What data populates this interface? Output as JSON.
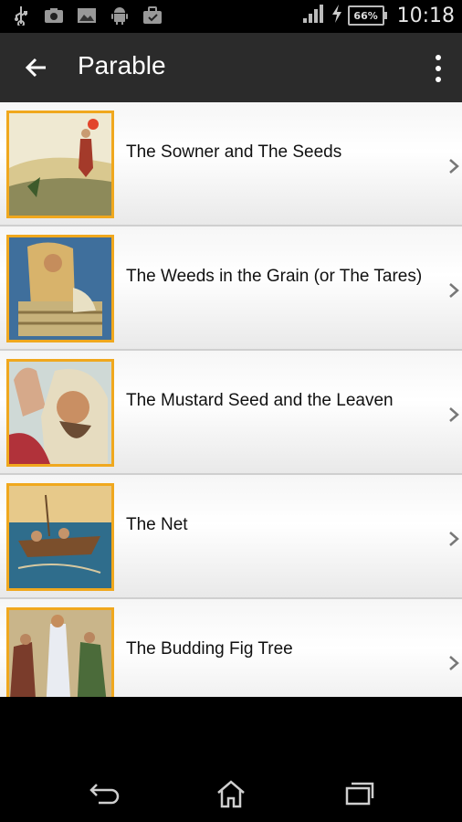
{
  "status_bar": {
    "icons": [
      "usb-icon",
      "screenshot-icon",
      "image-icon",
      "android-icon",
      "briefcase-icon"
    ],
    "battery_percent": "66%",
    "time": "10:18"
  },
  "action_bar": {
    "title": "Parable"
  },
  "list": {
    "items": [
      {
        "label": "The Sowner and The Seeds"
      },
      {
        "label": "The Weeds in the Grain (or The Tares)"
      },
      {
        "label": "The Mustard Seed and the Leaven"
      },
      {
        "label": "The Net"
      },
      {
        "label": "The Budding Fig Tree"
      }
    ]
  },
  "colors": {
    "accent_border": "#f0a81e",
    "action_bar": "#2b2b2b"
  }
}
